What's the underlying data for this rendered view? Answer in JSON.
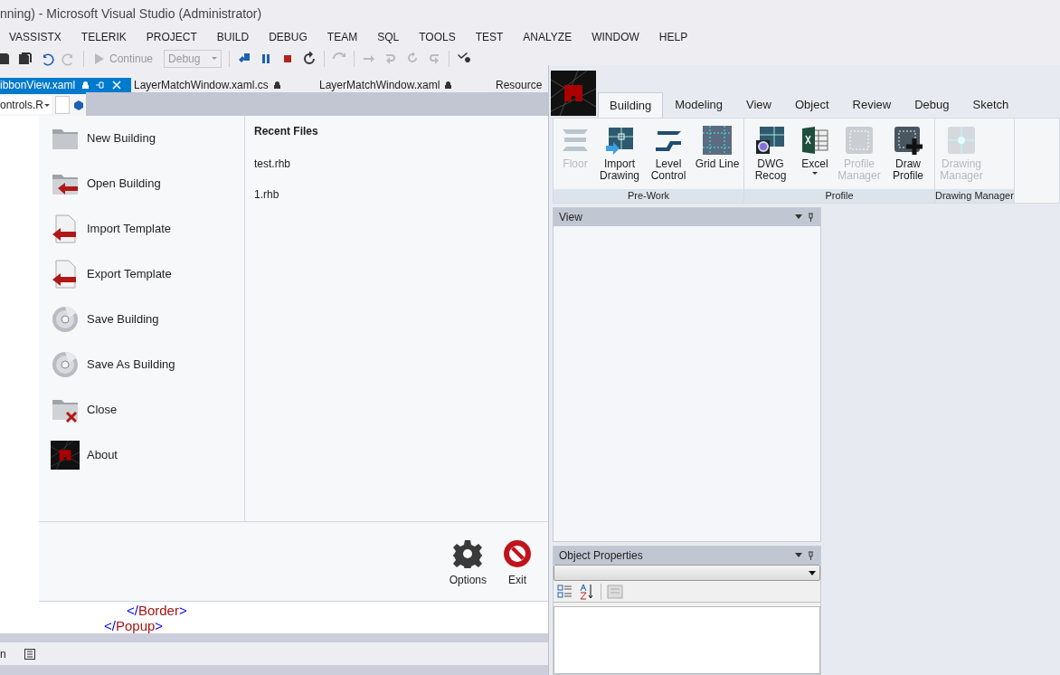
{
  "vs": {
    "title": "nning) - Microsoft Visual Studio (Administrator)",
    "menu": [
      "VASSISTX",
      "TELERIK",
      "PROJECT",
      "BUILD",
      "DEBUG",
      "TEAM",
      "SQL",
      "TOOLS",
      "TEST",
      "ANALYZE",
      "WINDOW",
      "HELP"
    ],
    "toolbar": {
      "continue": "Continue",
      "config": "Debug"
    },
    "doc_tabs": [
      {
        "label": "ibbonView.xaml",
        "selected": true
      },
      {
        "label": "LayerMatchWindow.xaml.cs",
        "selected": false
      },
      {
        "label": "LayerMatchWindow.xaml",
        "selected": false
      },
      {
        "label": "Resource",
        "selected": false
      }
    ],
    "type_combo": "ontrols.R",
    "code_lines": [
      {
        "prefix": "</",
        "tag": "Border",
        "suffix": ">"
      },
      {
        "prefix": "</",
        "tag": "Popup",
        "suffix": ">"
      }
    ],
    "bottom_tab": "n"
  },
  "backstage": {
    "items": [
      {
        "label": "New Building",
        "kind": "folder"
      },
      {
        "label": "Open Building",
        "kind": "open"
      },
      {
        "label": "Import Template",
        "kind": "import"
      },
      {
        "label": "Export Template",
        "kind": "import"
      },
      {
        "label": "Save Building",
        "kind": "save"
      },
      {
        "label": "Save As Building",
        "kind": "save"
      },
      {
        "label": "Close",
        "kind": "close"
      },
      {
        "label": "About",
        "kind": "about"
      }
    ],
    "recent_title": "Recent Files",
    "recent": [
      "test.rhb",
      "1.rhb"
    ],
    "footer_buttons": [
      {
        "label": "Options",
        "kind": "options"
      },
      {
        "label": "Exit",
        "kind": "exit"
      }
    ]
  },
  "app": {
    "tabs": [
      {
        "label": "Building",
        "selected": true
      },
      {
        "label": "Modeling",
        "selected": false
      },
      {
        "label": "View",
        "selected": false
      },
      {
        "label": "Object",
        "selected": false
      },
      {
        "label": "Review",
        "selected": false
      },
      {
        "label": "Debug",
        "selected": false
      },
      {
        "label": "Sketch",
        "selected": false
      }
    ],
    "groups": [
      {
        "title": "Pre-Work",
        "buttons": [
          {
            "label": "Floor",
            "kind": "floor",
            "disabled": true,
            "dropdown": false
          },
          {
            "label": "Import Drawing",
            "kind": "import",
            "disabled": false,
            "dropdown": false
          },
          {
            "label": "Level Control",
            "kind": "level",
            "disabled": false,
            "dropdown": false
          },
          {
            "label": "Grid Line",
            "kind": "grid",
            "disabled": false,
            "dropdown": false
          }
        ]
      },
      {
        "title": "Profile",
        "buttons": [
          {
            "label": "DWG Recog",
            "kind": "dwg",
            "disabled": false,
            "dropdown": false
          },
          {
            "label": "Excel",
            "kind": "excel",
            "disabled": false,
            "dropdown": true
          },
          {
            "label": "Profile Manager",
            "kind": "profile",
            "disabled": true,
            "dropdown": false
          },
          {
            "label": "Draw Profile",
            "kind": "profileadd",
            "disabled": false,
            "dropdown": false
          }
        ]
      },
      {
        "title": "Drawing Manager",
        "buttons": [
          {
            "label": "Drawing Manager",
            "kind": "drawing",
            "disabled": true,
            "dropdown": false
          }
        ]
      }
    ],
    "view_panel": {
      "title": "View"
    },
    "properties_panel": {
      "title": "Object Properties"
    }
  }
}
